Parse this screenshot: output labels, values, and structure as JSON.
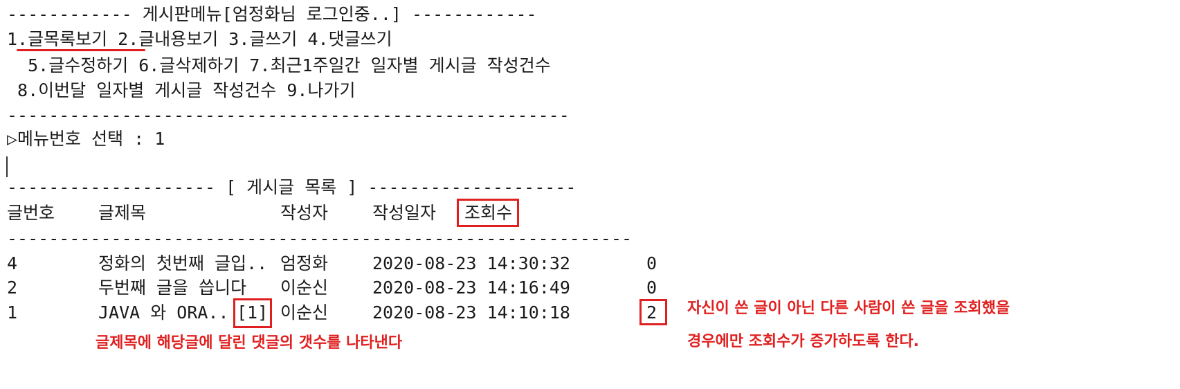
{
  "menu": {
    "header": "------------ 게시판메뉴[엄정화님 로그인중..] ------------",
    "row1": "1.글목록보기 2.글내용보기 3.글쓰기 4.댓글쓰기",
    "row2": "  5.글수정하기 6.글삭제하기 7.최근1주일간 일자별 게시글 작성건수",
    "row3": " 8.이번달 일자별 게시글 작성건수 9.나가기",
    "separator": "------------------------------------------------------"
  },
  "prompt": {
    "text": "▷메뉴번호 선택 : 1"
  },
  "list": {
    "title": "-------------------- [ 게시글 목록 ] --------------------",
    "columns": [
      "글번호",
      "글제목",
      "작성자",
      "작성일자",
      "조회수"
    ],
    "separator": "------------------------------------------------------------",
    "rows": [
      {
        "no": "4",
        "title": "정화의 첫번째 글입..",
        "writer": "엄정화",
        "date": "2020-08-23 14:30:32",
        "views": "0"
      },
      {
        "no": "2",
        "title": "두번째 글을 씁니다",
        "writer": "이순신",
        "date": "2020-08-23 14:16:49",
        "views": "0"
      },
      {
        "no": "1",
        "title": "JAVA 와 ORA..",
        "comment_count": "[1]",
        "writer": "이순신",
        "date": "2020-08-23 14:10:18",
        "views": "2"
      }
    ]
  },
  "annotations": {
    "comment_note": "글제목에 해당글에 달린 댓글의 갯수를 나타낸다",
    "views_note_line1": "자신이 쓴 글이 아닌 다른 사람이 쓴 글을 조회했을",
    "views_note_line2": "경우에만 조회수가 증가하도록 한다."
  },
  "colors": {
    "annotation": "#e02020",
    "text": "#1a1a1a"
  }
}
